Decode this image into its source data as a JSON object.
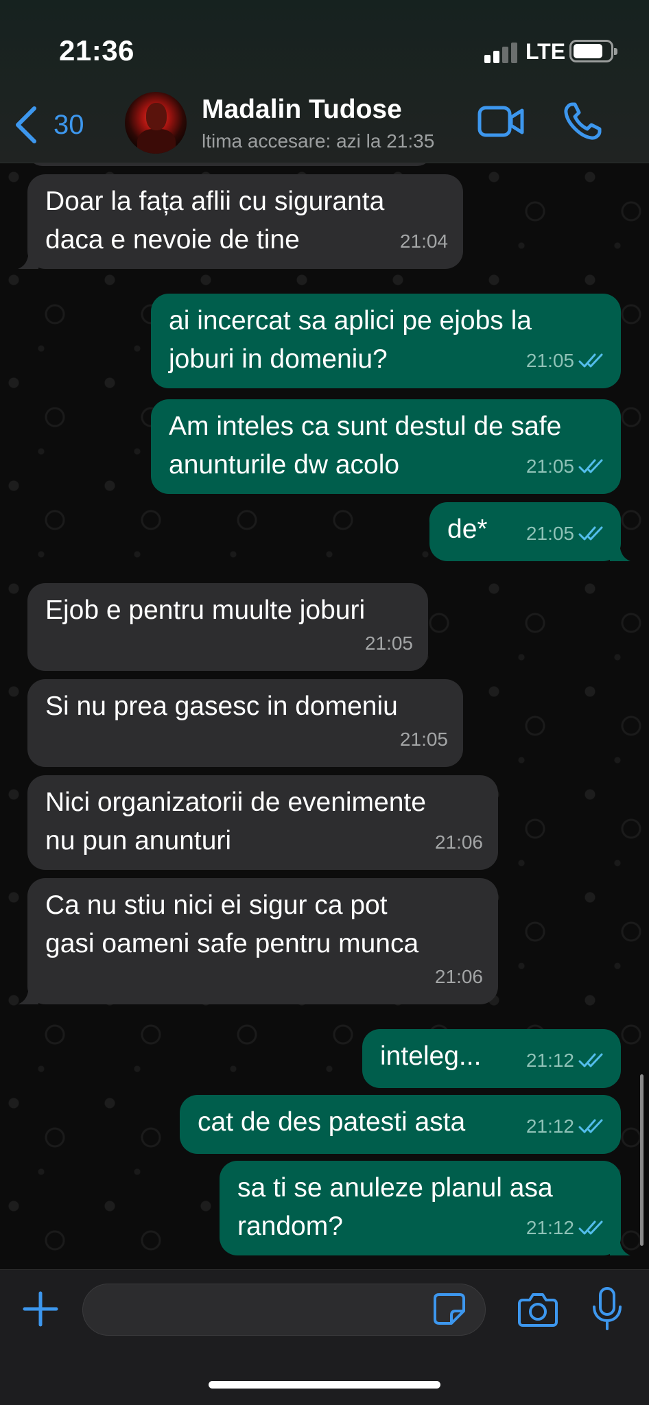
{
  "status_bar": {
    "time": "21:36",
    "network": "LTE",
    "signal_bars": 2,
    "battery_icon": "battery-icon"
  },
  "header": {
    "back_count": "30",
    "contact_name": "Madalin Tudose",
    "last_seen": "ltima accesare: azi la 21:35",
    "icons": [
      "back-chevron-icon",
      "video-call-icon",
      "phone-call-icon"
    ],
    "accent_color": "#3d97ee"
  },
  "messages": [
    {
      "direction": "in",
      "lines": [
        "Doar la fața aflii cu siguranta",
        "daca e nevoie de tine"
      ],
      "time": "21:04"
    },
    {
      "direction": "out",
      "lines": [
        "ai incercat sa aplici pe ejobs la",
        "joburi in domeniu?"
      ],
      "time": "21:05",
      "read": true
    },
    {
      "direction": "out",
      "lines": [
        "Am inteles ca sunt destul de safe",
        "anunturile dw acolo"
      ],
      "time": "21:05",
      "read": true
    },
    {
      "direction": "out",
      "lines": [
        "de*"
      ],
      "time": "21:05",
      "read": true
    },
    {
      "direction": "in",
      "lines": [
        "Ejob e pentru muulte joburi"
      ],
      "time": "21:05"
    },
    {
      "direction": "in",
      "lines": [
        "Si nu prea gasesc in domeniu"
      ],
      "time": "21:05"
    },
    {
      "direction": "in",
      "lines": [
        "Nici organizatorii de evenimente",
        "nu  pun anunturi"
      ],
      "time": "21:06"
    },
    {
      "direction": "in",
      "lines": [
        "Ca nu stiu nici ei sigur ca pot",
        "gasi oameni safe pentru munca"
      ],
      "time": "21:06"
    },
    {
      "direction": "out",
      "lines": [
        "inteleg..."
      ],
      "time": "21:12",
      "read": true
    },
    {
      "direction": "out",
      "lines": [
        "cat de des patesti asta"
      ],
      "time": "21:12",
      "read": true
    },
    {
      "direction": "out",
      "lines": [
        "sa ti se anuleze planul asa",
        "random?"
      ],
      "time": "21:12",
      "read": true
    }
  ],
  "composer": {
    "icons": [
      "plus-icon",
      "sticker-icon",
      "camera-icon",
      "microphone-icon"
    ]
  },
  "colors": {
    "incoming_bubble": "#2d2d2f",
    "outgoing_bubble": "#005e4c",
    "read_ticks": "#53bdeb"
  }
}
